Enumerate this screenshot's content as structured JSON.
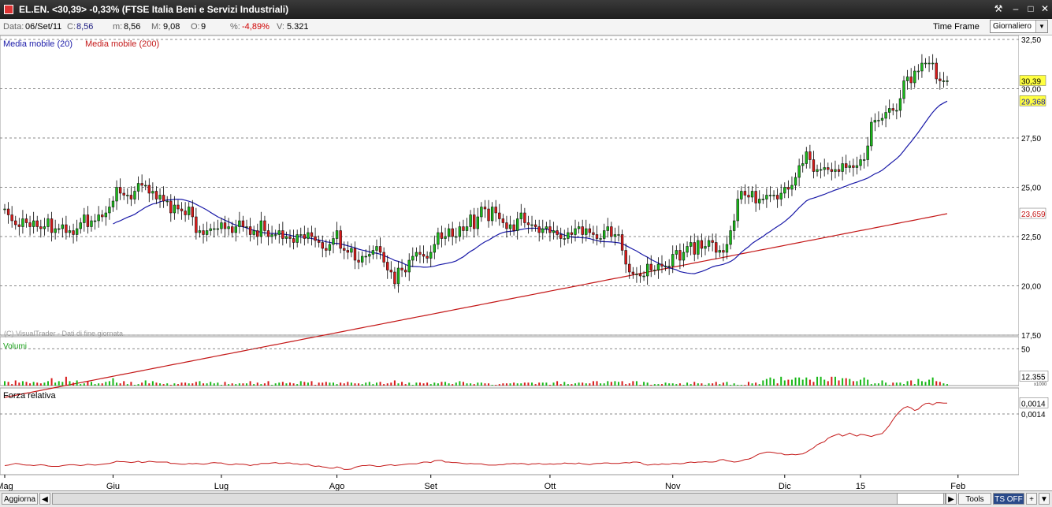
{
  "window": {
    "title": "EL.EN. <30,39> -0,33%  (FTSE Italia Beni e Servizi Industriali)",
    "buttons": [
      "⚒",
      "–",
      "□",
      "✕"
    ]
  },
  "infobar": {
    "data_label": "Data:",
    "data_value": "06/Set/11",
    "c_label": "C:",
    "c_value": "8,56",
    "m_label": "m:",
    "m_value": "8,56",
    "M_label": "M:",
    "M_value": "9,08",
    "o_label": "O:",
    "o_value": "9",
    "pct_label": "%:",
    "pct_value": "-4,89%",
    "v_label": "V:",
    "v_value": "5.321",
    "timeframe_label": "Time Frame",
    "timeframe_value": "Giornaliero"
  },
  "statusbar": {
    "aggiorna": "Aggiorna",
    "tools": "Tools",
    "ts_off": "TS OFF",
    "plus": "+"
  },
  "colors": {
    "up": "#19b819",
    "down": "#d81a1a",
    "ma20": "#1a1aa8",
    "ma200": "#c41818",
    "rs_line": "#c41818"
  },
  "chart_data": [
    {
      "type": "candlestick",
      "panel": "price",
      "legend": [
        "Media mobile (20)",
        "Media mobile (200)"
      ],
      "watermark": "(C) VisualTrader - Dati di fine giornata",
      "yticks": [
        "32,50",
        "30,00",
        "27,50",
        "25,00",
        "22,50",
        "20,00",
        "17,50"
      ],
      "ytick_values": [
        32.5,
        30,
        27.5,
        25,
        22.5,
        20,
        17.5
      ],
      "ylim": [
        17.5,
        32.5
      ],
      "x_tick_labels": [
        "Mag",
        "Giu",
        "Lug",
        "Ago",
        "Set",
        "Ott",
        "Nov",
        "Dic",
        "15",
        "Feb"
      ],
      "x_tick_index": [
        0,
        30,
        60,
        92,
        118,
        151,
        185,
        216,
        237,
        264
      ],
      "price_marker": "30,39",
      "ma20_marker": "29,368",
      "ma200_marker": "23,659",
      "ma20_last": 29.368,
      "ma200_last": 23.659,
      "close": [
        23.9,
        23.6,
        23.3,
        23.1,
        23.0,
        23.4,
        23.2,
        23.0,
        23.3,
        23.0,
        22.9,
        23.0,
        23.4,
        22.7,
        22.9,
        22.9,
        23.1,
        22.7,
        22.8,
        22.6,
        22.9,
        23.2,
        23.6,
        23.0,
        23.3,
        23.3,
        23.6,
        23.5,
        23.7,
        24.0,
        24.3,
        25.0,
        24.7,
        24.6,
        24.6,
        24.4,
        24.8,
        25.2,
        25.1,
        25.1,
        24.7,
        24.8,
        24.4,
        24.6,
        24.3,
        24.3,
        23.7,
        24.1,
        23.9,
        23.8,
        23.6,
        24.0,
        23.5,
        22.7,
        22.8,
        22.6,
        22.8,
        22.9,
        22.9,
        22.9,
        23.2,
        22.9,
        23.0,
        22.7,
        23.0,
        23.3,
        23.0,
        23.0,
        22.6,
        22.8,
        22.5,
        23.3,
        22.8,
        22.5,
        22.6,
        22.6,
        22.8,
        22.4,
        22.5,
        22.4,
        22.2,
        22.6,
        22.6,
        22.4,
        22.7,
        22.5,
        22.3,
        22.2,
        21.9,
        21.8,
        22.1,
        22.4,
        22.8,
        21.9,
        21.8,
        21.7,
        21.9,
        21.3,
        21.2,
        21.5,
        21.5,
        21.6,
        21.8,
        22.0,
        21.7,
        21.2,
        20.8,
        20.7,
        20.1,
        20.9,
        20.8,
        20.7,
        21.3,
        21.5,
        21.7,
        21.6,
        21.5,
        21.4,
        21.7,
        22.1,
        22.7,
        22.4,
        22.5,
        22.9,
        22.5,
        22.5,
        23.0,
        22.8,
        23.0,
        23.6,
        22.9,
        23.5,
        24.0,
        23.9,
        23.3,
        24.0,
        23.7,
        23.4,
        23.2,
        22.9,
        23.1,
        22.8,
        23.4,
        23.7,
        23.2,
        23.1,
        23.1,
        23.0,
        22.7,
        22.9,
        23.0,
        22.7,
        22.8,
        22.6,
        22.4,
        22.4,
        22.7,
        22.6,
        22.9,
        23.0,
        22.6,
        22.9,
        22.7,
        22.6,
        22.4,
        22.4,
        22.8,
        23.0,
        22.5,
        22.6,
        22.6,
        21.8,
        21.1,
        20.7,
        20.6,
        20.6,
        20.5,
        20.5,
        21.1,
        20.8,
        20.8,
        21.1,
        21.0,
        21.0,
        21.0,
        21.6,
        21.8,
        21.3,
        21.7,
        22.0,
        22.2,
        21.6,
        22.3,
        21.9,
        22.0,
        22.3,
        22.2,
        21.7,
        21.8,
        21.7,
        22.1,
        22.8,
        23.3,
        24.4,
        24.8,
        24.6,
        24.5,
        24.8,
        24.2,
        24.4,
        24.4,
        24.6,
        24.6,
        24.6,
        24.4,
        24.7,
        25.0,
        24.9,
        25.1,
        25.5,
        26.1,
        26.2,
        26.8,
        26.4,
        25.8,
        25.9,
        25.9,
        26.0,
        25.9,
        25.8,
        25.9,
        25.8,
        26.2,
        26.0,
        26.1,
        26.0,
        26.1,
        26.4,
        26.4,
        27.1,
        28.3,
        28.4,
        28.4,
        28.5,
        28.8,
        29.0,
        28.9,
        28.9,
        29.5,
        30.4,
        30.6,
        30.3,
        30.9,
        30.9,
        31.3,
        31.3,
        31.3,
        31.3,
        30.5,
        30.4,
        30.4,
        30.4
      ],
      "volume_label": "Volumi",
      "volume_yticks": [
        "50",
        "12.355"
      ],
      "volume_unit": "x1000",
      "volume_max": 60,
      "volume": [
        6,
        5,
        2,
        7,
        4,
        6,
        5,
        3,
        5,
        4,
        3,
        4,
        6,
        10,
        4,
        6,
        5,
        12,
        6,
        4,
        7,
        2,
        3,
        6,
        5,
        2,
        3,
        3,
        5,
        6,
        10,
        4,
        3,
        6,
        2,
        5,
        1,
        2,
        4,
        7,
        3,
        6,
        4,
        3,
        2,
        3,
        1,
        3,
        2,
        4,
        4,
        3,
        3,
        5,
        6,
        3,
        3,
        5,
        3,
        4,
        1,
        5,
        2,
        3,
        2,
        3,
        3,
        3,
        6,
        2,
        4,
        2,
        3,
        6,
        1,
        3,
        4,
        5,
        3,
        4,
        3,
        2,
        6,
        5,
        4,
        6,
        1,
        4,
        4,
        5,
        4,
        4,
        2,
        4,
        3,
        5,
        4,
        3,
        3,
        2,
        4,
        5,
        2,
        4,
        5,
        2,
        3,
        4,
        7,
        3,
        5,
        2,
        4,
        1,
        4,
        4,
        3,
        4,
        2,
        4,
        3,
        5,
        5,
        3,
        2,
        4,
        6,
        5,
        3,
        3,
        2,
        4,
        4,
        3,
        3,
        1,
        1,
        2,
        3,
        3,
        3,
        4,
        3,
        3,
        4,
        4,
        4,
        2,
        4,
        4,
        4,
        1,
        4,
        6,
        2,
        5,
        2,
        2,
        3,
        4,
        4,
        3,
        3,
        6,
        6,
        3,
        3,
        6,
        5,
        6,
        5,
        6,
        2,
        3,
        6,
        6,
        1,
        5,
        4,
        1,
        2,
        2,
        2,
        4,
        3,
        3,
        2,
        3,
        1,
        4,
        2,
        5,
        3,
        3,
        1,
        3,
        3,
        5,
        2,
        4,
        5,
        1,
        3,
        1,
        1,
        1,
        5,
        3,
        4,
        2,
        7,
        9,
        11,
        9,
        3,
        12,
        7,
        8,
        8,
        11,
        11,
        8,
        11,
        8,
        5,
        12,
        12,
        8,
        6,
        12,
        12,
        7,
        10,
        10,
        9,
        6,
        6,
        8,
        11,
        8,
        2,
        3,
        3,
        7,
        4,
        1,
        4,
        4,
        4,
        2,
        6,
        7,
        2,
        9,
        6,
        5,
        8,
        11,
        6,
        5,
        3,
        2,
        6,
        11,
        13,
        12,
        13,
        5,
        6,
        11,
        4,
        3,
        8,
        5,
        4,
        1
      ],
      "rs_label": "Forza relativa",
      "rs_marker": "0,0014",
      "rs_ref_label": "0,0014",
      "rs_ref_value": 0.0014,
      "rs_ylim": [
        0.0,
        0.002
      ],
      "rs": [
        0.00021,
        0.00022,
        0.00024,
        0.00026,
        0.00025,
        0.00023,
        0.00022,
        0.00022,
        0.00021,
        0.00022,
        0.00023,
        0.00022,
        0.0002,
        0.00019,
        0.00019,
        0.00019,
        0.00021,
        0.00022,
        0.00023,
        0.00023,
        0.00022,
        0.00021,
        0.00022,
        0.00024,
        0.00023,
        0.00022,
        0.00023,
        0.00024,
        0.00025,
        0.00026,
        0.00028,
        0.00031,
        0.0003,
        0.0003,
        0.00029,
        0.00028,
        0.00029,
        0.00031,
        0.00028,
        0.00029,
        0.00031,
        0.0003,
        0.00029,
        0.00029,
        0.00029,
        0.00029,
        0.00026,
        0.00026,
        0.00025,
        0.00024,
        0.00024,
        0.00026,
        0.00025,
        0.00026,
        0.00025,
        0.00024,
        0.00025,
        0.00027,
        0.00028,
        0.00027,
        0.00027,
        0.00025,
        0.00023,
        0.00023,
        0.00025,
        0.00024,
        0.00024,
        0.00023,
        0.00021,
        0.00023,
        0.00023,
        0.00026,
        0.00026,
        0.00026,
        0.00027,
        0.00028,
        0.00026,
        0.00026,
        0.00027,
        0.00027,
        0.00025,
        0.00025,
        0.00023,
        0.00024,
        0.00024,
        0.00021,
        0.00019,
        0.0002,
        0.00018,
        0.00017,
        0.00015,
        0.00015,
        0.00018,
        0.00016,
        0.00012,
        0.00012,
        0.00013,
        0.00017,
        0.00019,
        0.00021,
        0.00021,
        0.00022,
        0.00021,
        0.00019,
        0.00019,
        0.00021,
        0.00022,
        0.00023,
        0.00021,
        0.00022,
        0.00023,
        0.00024,
        0.00025,
        0.00025,
        0.00025,
        0.00027,
        0.00029,
        0.00029,
        0.00028,
        0.00032,
        0.00033,
        0.00033,
        0.00029,
        0.00029,
        0.00028,
        0.00028,
        0.00027,
        0.00026,
        0.00025,
        0.00026,
        0.00025,
        0.00025,
        0.00025,
        0.00023,
        0.00022,
        0.00022,
        0.00022,
        0.00023,
        0.00023,
        0.00025,
        0.00025,
        0.00026,
        0.00025,
        0.00026,
        0.00025,
        0.00023,
        0.00025,
        0.00025,
        0.00026,
        0.00024,
        0.00024,
        0.00025,
        0.00024,
        0.00025,
        0.00025,
        0.00027,
        0.00026,
        0.00026,
        0.00025,
        0.00027,
        0.00025,
        0.00024,
        0.00023,
        0.00025,
        0.00026,
        0.00026,
        0.00027,
        0.00027,
        0.00026,
        0.00026,
        0.00026,
        0.00027,
        0.00028,
        0.00027,
        0.00029,
        0.00029,
        0.00028,
        0.00024,
        0.00022,
        0.00023,
        0.00024,
        0.00023,
        0.00025,
        0.00024,
        0.00024,
        0.00026,
        0.00026,
        0.00025,
        0.00026,
        0.00028,
        0.00029,
        0.00028,
        0.00029,
        0.00029,
        0.0003,
        0.00029,
        0.00029,
        0.0003,
        0.00034,
        0.00035,
        0.00032,
        0.00031,
        0.00029,
        0.0003,
        0.00032,
        0.00035,
        0.00036,
        0.00039,
        0.00044,
        0.00048,
        0.0005,
        0.00052,
        0.00052,
        0.00051,
        0.00049,
        0.00049,
        0.00046,
        0.00046,
        0.00047,
        0.00046,
        0.00047,
        0.00048,
        0.00052,
        0.00057,
        0.00062,
        0.00069,
        0.00073,
        0.00076,
        0.00084,
        0.00088,
        0.00091,
        0.00094,
        0.00089,
        0.00092,
        0.00096,
        0.00092,
        0.00089,
        0.00093,
        0.00092,
        0.0009,
        0.00088,
        0.00091,
        0.00093,
        0.00095,
        0.00104,
        0.00114,
        0.00127,
        0.00138,
        0.00147,
        0.00154,
        0.00157,
        0.00154,
        0.00148,
        0.00151,
        0.00159,
        0.00164,
        0.00165,
        0.00161,
        0.00166,
        0.00166,
        0.00165,
        0.00165,
        0.00164,
        0.00161,
        0.00155,
        0.00148,
        0.00135,
        0.00132,
        0.00131,
        0.00129
      ]
    }
  ]
}
